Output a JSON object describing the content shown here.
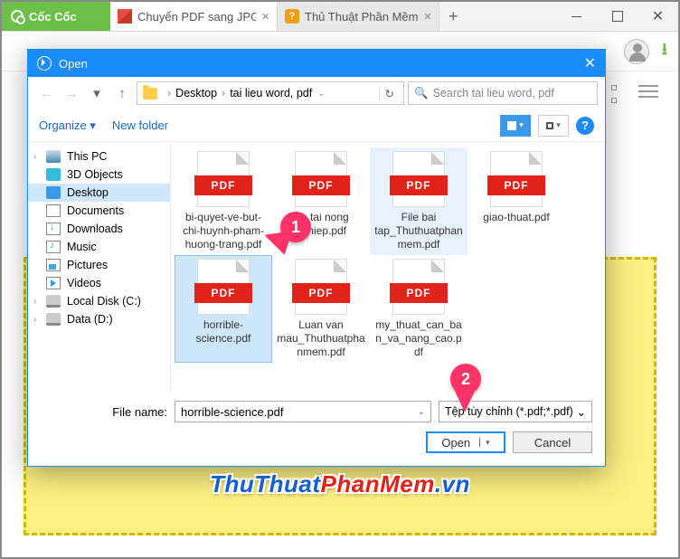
{
  "browser": {
    "logo_text": "Cốc Cốc",
    "tabs": [
      {
        "title": "Chuyển PDF sang JPG",
        "active": true
      },
      {
        "title": "Thủ Thuật Phần Mềm",
        "active": false
      }
    ],
    "window": {
      "min": "—",
      "max": "□",
      "close": "✕"
    }
  },
  "page": {
    "grid_visible": true,
    "dropzone_visible": true
  },
  "dialog": {
    "title": "Open",
    "nav": {
      "back": "←",
      "fwd": "→",
      "up": "↑",
      "path": [
        "Desktop",
        "tai lieu word, pdf"
      ],
      "refresh": "↻"
    },
    "search_placeholder": "Search tai lieu word, pdf",
    "commands": {
      "organize": "Organize ▾",
      "new_folder": "New folder",
      "help": "?"
    },
    "tree": [
      {
        "label": "This PC",
        "icon": "pc",
        "expandable": true
      },
      {
        "label": "3D Objects",
        "icon": "obj"
      },
      {
        "label": "Desktop",
        "icon": "desk",
        "selected": true
      },
      {
        "label": "Documents",
        "icon": "doc"
      },
      {
        "label": "Downloads",
        "icon": "dl"
      },
      {
        "label": "Music",
        "icon": "mus"
      },
      {
        "label": "Pictures",
        "icon": "pic"
      },
      {
        "label": "Videos",
        "icon": "vid"
      },
      {
        "label": "Local Disk (C:)",
        "icon": "disk",
        "expandable": true
      },
      {
        "label": "Data (D:)",
        "icon": "disk",
        "expandable": true
      }
    ],
    "files": [
      {
        "name": "bi-quyet-ve-but-chi-huynh-pham-huong-trang.pdf",
        "badge": "PDF"
      },
      {
        "name": "De tai nong nghiep.pdf",
        "badge": "PDF"
      },
      {
        "name": "File bai tap_Thuthuatphanmem.pdf",
        "badge": "PDF",
        "highlight": true
      },
      {
        "name": "giao-thuat.pdf",
        "badge": "PDF"
      },
      {
        "name": "horrible-science.pdf",
        "badge": "PDF",
        "selected": true
      },
      {
        "name": "Luan van mau_Thuthuatphanmem.pdf",
        "badge": "PDF"
      },
      {
        "name": "my_thuat_can_ban_va_nang_cao.pdf",
        "badge": "PDF"
      }
    ],
    "file_name_label": "File name:",
    "file_name_value": "horrible-science.pdf",
    "file_type_value": "Tệp tùy chỉnh (*.pdf;*.pdf)",
    "open_btn": "Open",
    "cancel_btn": "Cancel"
  },
  "callouts": {
    "c1": "1",
    "c2": "2"
  },
  "watermark": {
    "blue": "ThuThuat",
    "red": "PhanMem",
    "suffix": ".vn"
  }
}
